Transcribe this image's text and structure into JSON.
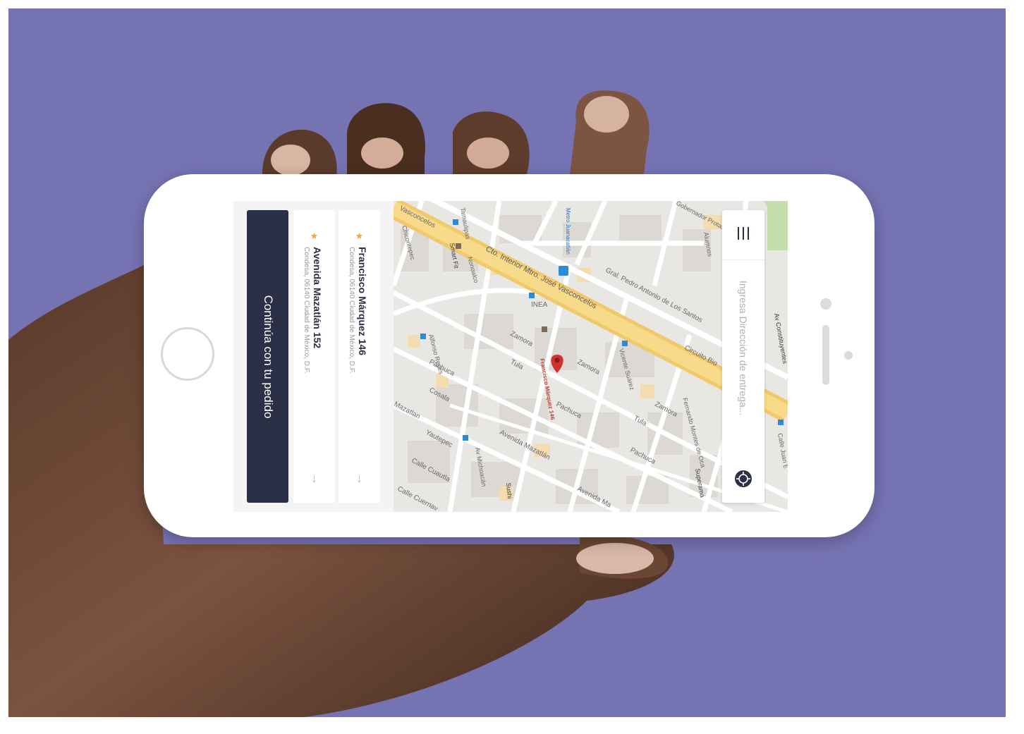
{
  "app": {
    "continue_label": "Continúa con tu pedido",
    "search": {
      "placeholder": "Ingresa Dirección de entrega..."
    },
    "saved_addresses": [
      {
        "title": "Francisco Márquez 146",
        "subtitle": "Condesa, 06140 Ciudad de México, D.F.",
        "icon": "star-icon"
      },
      {
        "title": "Avenida Mazatlán 152",
        "subtitle": "Condesa, 06140 Ciudad de México, D.F.",
        "icon": "star-icon"
      }
    ],
    "icons": {
      "menu": "menu-icon",
      "locate": "locate-icon",
      "arrow": "arrow-down-icon"
    }
  },
  "map": {
    "pin_label": "Francisco Márquez 146",
    "streets": [
      "Vasconcelos",
      "Cto. Interior Mtro. José Vasconcelos",
      "Gral. Pedro Antonio de Los Santos",
      "Circuito Bio",
      "Av Constituyentes",
      "Gobernador Protasio",
      "Alumnos",
      "INEA",
      "Zamora",
      "Tula",
      "Pachuca",
      "Cosala",
      "Mazatlán",
      "Avenida Mazatlán",
      "Yautepec",
      "Calle Cuautla",
      "Calle Cuernav",
      "Av Michoacán",
      "Alfonso Reyes",
      "Nonoalco",
      "Vicente Suárez",
      "Fernando Montes de Oca",
      "Superama",
      "Sushi",
      "Smart Fit",
      "Metro Juanacatlán",
      "Chicontepec",
      "Calle Juan E",
      "Tamaulipas"
    ]
  },
  "colors": {
    "background": "#7673b3",
    "button": "#2b3047",
    "star": "#f5a623",
    "pin": "#d0312d",
    "highway": "#f6d36e"
  }
}
